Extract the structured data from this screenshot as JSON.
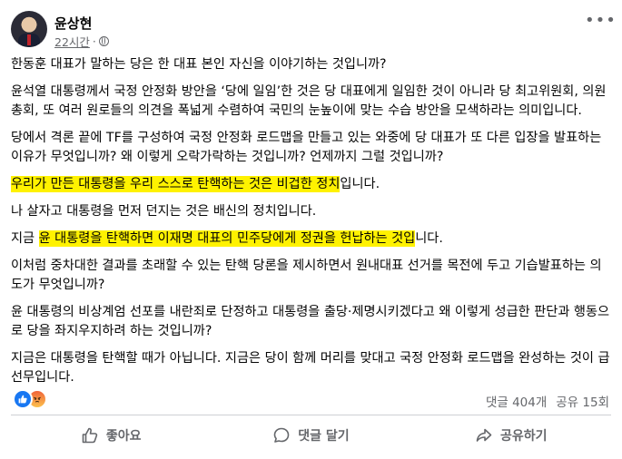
{
  "author": {
    "name": "윤상현",
    "time": "22시간",
    "separator": "·"
  },
  "post": {
    "paragraphs": [
      {
        "text": "한동훈 대표가 말하는 당은 한 대표 본인 자신을 이야기하는 것입니까?"
      },
      {
        "text": "윤석열 대통령께서 국정 안정화 방안을 ‘당에 일임’한 것은 당 대표에게 일임한 것이 아니라 당 최고위원회, 의원총회, 또 여러 원로들의 의견을 폭넓게 수렴하여 국민의 눈높이에 맞는 수습 방안을 모색하라는 의미입니다."
      },
      {
        "text": "당에서 격론 끝에 TF를 구성하여 국정 안정화 로드맵을 만들고 있는 와중에 당 대표가 또 다른 입장을 발표하는 이유가 무엇입니까? 왜 이렇게 오락가락하는 것입니까? 언제까지 그럴 것입니까?"
      },
      {
        "prefix": "",
        "highlight": "우리가 만든 대통령을 우리 스스로 탄핵하는 것은 비겁한 정치",
        "suffix": "입니다."
      },
      {
        "text": "나 살자고 대통령을 먼저 던지는 것은 배신의 정치입니다."
      },
      {
        "prefix": "지금 ",
        "highlight": "윤 대통령을 탄핵하면 이재명 대표의 민주당에게 정권을 헌납하는 것입",
        "suffix": "니다."
      },
      {
        "text": "이처럼 중차대한 결과를 초래할 수 있는 탄핵 당론을 제시하면서 원내대표 선거를 목전에 두고 기습발표하는 의도가 무엇입니까?"
      },
      {
        "text": "윤 대통령의 비상계엄 선포를 내란죄로 단정하고 대통령을 출당·제명시키겠다고 왜 이렇게 성급한 판단과 행동으로 당을 좌지우지하려 하는 것입니까?"
      },
      {
        "text": "지금은 대통령을 탄핵할 때가 아닙니다. 지금은 당이 함께 머리를 맞대고 국정 안정화 로드맵을 완성하는 것이 급선무입니다."
      }
    ]
  },
  "stats": {
    "comments": "댓글 404개",
    "shares": "공유 15회"
  },
  "reactions": [
    "like-icon",
    "angry-icon"
  ],
  "actions": {
    "like": "좋아요",
    "comment": "댓글 달기",
    "share": "공유하기"
  },
  "colors": {
    "highlight": "#fff200",
    "like_blue": "#1877f2",
    "muted": "#65676b"
  }
}
